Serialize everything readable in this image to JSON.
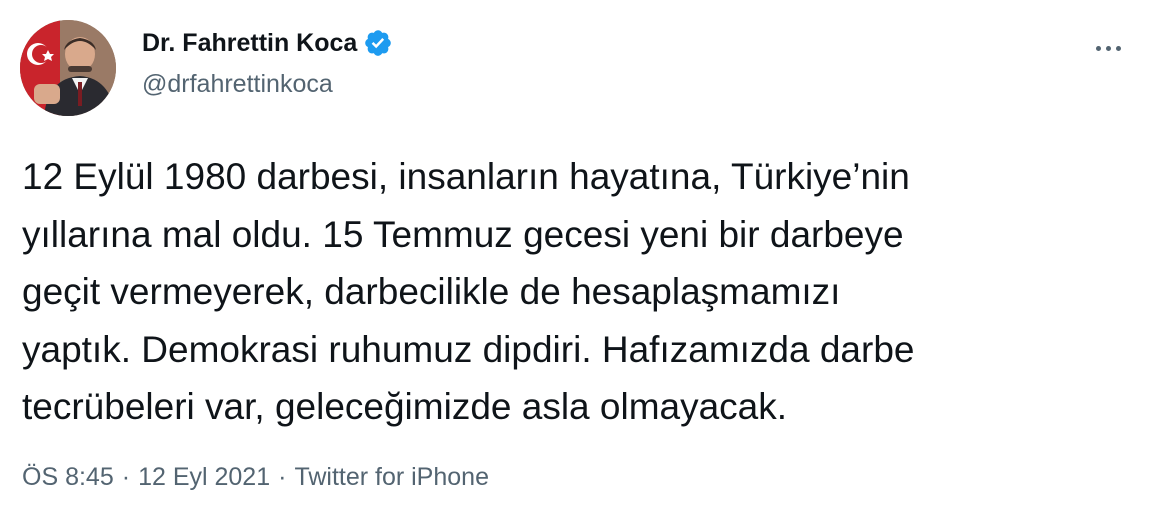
{
  "author": {
    "display_name": "Dr. Fahrettin Koca",
    "handle": "@drfahrettinkoca",
    "verified": true
  },
  "tweet": {
    "text_lines": [
      "12 Eylül 1980 darbesi, insanların hayatına, Türkiye’nin",
      "yıllarına mal oldu. 15 Temmuz gecesi yeni bir darbeye",
      "geçit vermeyerek, darbecilikle de hesaplaşmamızı",
      "yaptık. Demokrasi ruhumuz dipdiri. Hafızamızda darbe",
      "tecrübeleri var, geleceğimizde asla olmayacak."
    ]
  },
  "meta": {
    "time": "ÖS 8:45",
    "separator": "·",
    "date": "12 Eyl 2021",
    "source": "Twitter for iPhone"
  },
  "icons": {
    "verified": "verified-badge-icon",
    "more": "more-options-icon"
  },
  "colors": {
    "text": "#0f1419",
    "secondary": "#536471",
    "verified": "#1d9bf0",
    "flag_red": "#e30a17"
  }
}
